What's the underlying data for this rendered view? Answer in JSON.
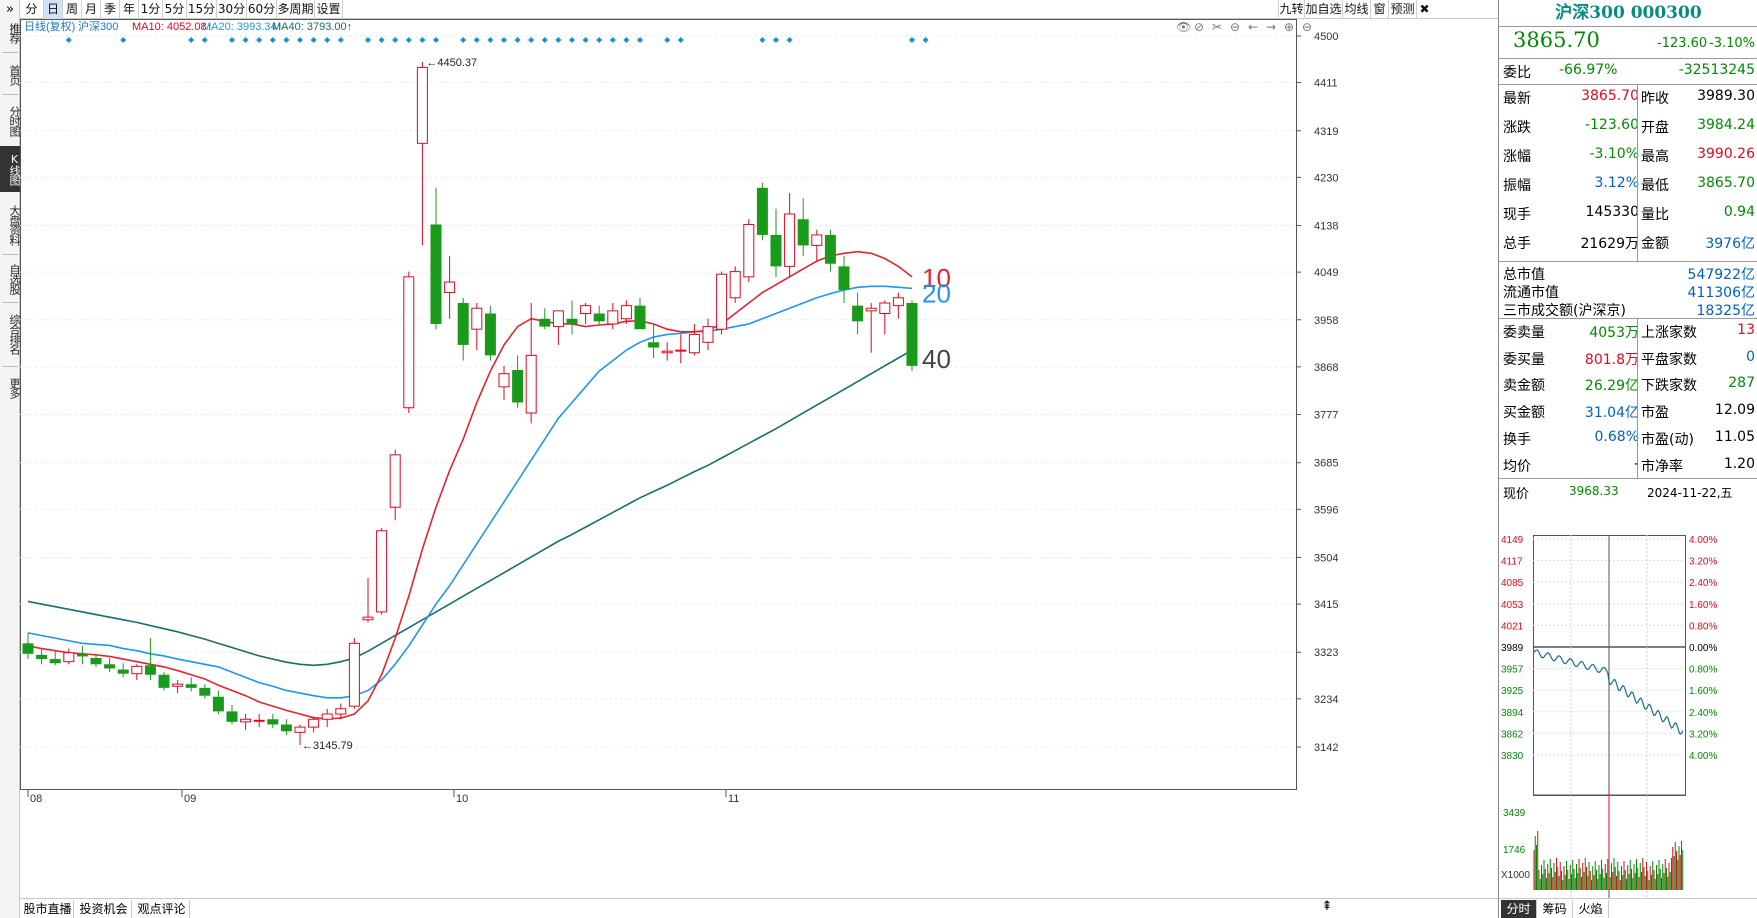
{
  "leftbar": {
    "items": [
      "推荐",
      "首页",
      "分时图",
      "K线图",
      "大盘资料",
      "自选股",
      "综合排名",
      "更多"
    ],
    "top_arrow": "»"
  },
  "toolbar": {
    "tabs": [
      "分时",
      "日",
      "周",
      "月",
      "季",
      "年",
      "1分",
      "5分",
      "15分",
      "30分",
      "60分",
      "多周期",
      "设置"
    ],
    "active": "日",
    "right_tabs": [
      "九转",
      "加自选",
      "均线",
      "窗",
      "预测"
    ],
    "close": "✖"
  },
  "ma_header": {
    "name": "日线(复权)",
    "stock": "沪深300",
    "ma10": "MA10: 4052.08↑",
    "ma20": "MA20: 3993.34↑",
    "ma40": "MA40: 3793.00↑"
  },
  "chart_icons": [
    "eye-icon",
    "eye-slash-icon",
    "scissors-icon",
    "zoom-out-icon",
    "arrow-left-icon",
    "arrow-right-icon",
    "plus-circle-icon",
    "minus-circle-icon"
  ],
  "chart_data": {
    "type": "candlestick",
    "ylim": [
      3100,
      4500
    ],
    "y_ticks": [
      "4500",
      "4411",
      "4319",
      "4230",
      "4138",
      "4049",
      "3958",
      "3868",
      "3777",
      "3685",
      "3596",
      "3504",
      "3415",
      "3323",
      "3234",
      "3142"
    ],
    "x_labels": [
      "08",
      "09",
      "10",
      "11"
    ],
    "annotations": [
      "4450.37",
      "3145.79"
    ],
    "ma_labels": [
      "10",
      "20",
      "40"
    ],
    "colors": {
      "up": "#e4081e",
      "down": "#1a9a1a",
      "ma10": "#e8222e",
      "ma20": "#2196e8",
      "ma40": "#1a6e6e",
      "diamond": "#1c90d0"
    },
    "candles": [
      [
        3340,
        3360,
        3310,
        3320
      ],
      [
        3318,
        3330,
        3300,
        3310
      ],
      [
        3310,
        3325,
        3298,
        3302
      ],
      [
        3305,
        3330,
        3300,
        3322
      ],
      [
        3320,
        3335,
        3300,
        3315
      ],
      [
        3312,
        3320,
        3295,
        3300
      ],
      [
        3300,
        3312,
        3285,
        3292
      ],
      [
        3290,
        3302,
        3275,
        3282
      ],
      [
        3282,
        3300,
        3270,
        3296
      ],
      [
        3298,
        3350,
        3270,
        3280
      ],
      [
        3280,
        3285,
        3250,
        3255
      ],
      [
        3258,
        3270,
        3245,
        3262
      ],
      [
        3262,
        3275,
        3248,
        3255
      ],
      [
        3255,
        3262,
        3235,
        3240
      ],
      [
        3238,
        3250,
        3205,
        3210
      ],
      [
        3210,
        3222,
        3185,
        3190
      ],
      [
        3190,
        3205,
        3175,
        3195
      ],
      [
        3192,
        3205,
        3180,
        3193
      ],
      [
        3195,
        3205,
        3178,
        3185
      ],
      [
        3185,
        3195,
        3165,
        3172
      ],
      [
        3170,
        3185,
        3145.79,
        3180
      ],
      [
        3180,
        3200,
        3170,
        3195
      ],
      [
        3195,
        3215,
        3180,
        3205
      ],
      [
        3205,
        3225,
        3195,
        3215
      ],
      [
        3220,
        3350,
        3215,
        3340
      ],
      [
        3385,
        3465,
        3380,
        3390
      ],
      [
        3400,
        3560,
        3395,
        3555
      ],
      [
        3600,
        3710,
        3575,
        3700
      ],
      [
        3790,
        4050,
        3780,
        4040
      ],
      [
        4295,
        4450.37,
        4100,
        4440
      ],
      [
        4140,
        4210,
        3940,
        3950
      ],
      [
        4010,
        4080,
        3960,
        4030
      ],
      [
        3990,
        4000,
        3880,
        3910
      ],
      [
        3940,
        3990,
        3900,
        3980
      ],
      [
        3970,
        3985,
        3880,
        3890
      ],
      [
        3830,
        3870,
        3805,
        3855
      ],
      [
        3862,
        3890,
        3790,
        3800
      ],
      [
        3780,
        3990,
        3760,
        3890
      ],
      [
        3960,
        3980,
        3940,
        3945
      ],
      [
        3945,
        3975,
        3910,
        3975
      ],
      [
        3960,
        3995,
        3930,
        3950
      ],
      [
        3970,
        3990,
        3950,
        3985
      ],
      [
        3970,
        3985,
        3948,
        3955
      ],
      [
        3950,
        3990,
        3940,
        3975
      ],
      [
        3960,
        3995,
        3950,
        3985
      ],
      [
        3985,
        4000,
        3940,
        3940
      ],
      [
        3915,
        3950,
        3885,
        3905
      ],
      [
        3895,
        3915,
        3880,
        3898
      ],
      [
        3900,
        3930,
        3875,
        3900
      ],
      [
        3895,
        3950,
        3890,
        3930
      ],
      [
        3915,
        3960,
        3900,
        3945
      ],
      [
        3940,
        4050,
        3930,
        4045
      ],
      [
        4000,
        4060,
        3990,
        4050
      ],
      [
        4040,
        4150,
        4030,
        4140
      ],
      [
        4210,
        4220,
        4110,
        4120
      ],
      [
        4120,
        4170,
        4040,
        4060
      ],
      [
        4060,
        4200,
        4040,
        4160
      ],
      [
        4150,
        4190,
        4080,
        4100
      ],
      [
        4100,
        4130,
        4070,
        4120
      ],
      [
        4120,
        4130,
        4050,
        4065
      ],
      [
        4060,
        4080,
        3990,
        4015
      ],
      [
        3985,
        4010,
        3930,
        3955
      ],
      [
        3975,
        3990,
        3895,
        3980
      ],
      [
        3970,
        3995,
        3930,
        3990
      ],
      [
        3985,
        4010,
        3960,
        4000
      ],
      [
        3990,
        3995,
        3860,
        3870
      ]
    ],
    "ma10": [
      3335,
      3330,
      3326,
      3322,
      3320,
      3318,
      3315,
      3310,
      3305,
      3300,
      3295,
      3288,
      3280,
      3272,
      3260,
      3250,
      3240,
      3228,
      3220,
      3212,
      3205,
      3198,
      3196,
      3197,
      3205,
      3230,
      3280,
      3350,
      3430,
      3520,
      3600,
      3670,
      3730,
      3800,
      3860,
      3910,
      3945,
      3960,
      3955,
      3950,
      3950,
      3945,
      3948,
      3950,
      3955,
      3956,
      3950,
      3940,
      3935,
      3935,
      3938,
      3950,
      3970,
      3990,
      4010,
      4025,
      4040,
      4055,
      4070,
      4080,
      4085,
      4088,
      4085,
      4075,
      4060,
      4040
    ],
    "ma20": [
      3360,
      3355,
      3350,
      3345,
      3340,
      3338,
      3336,
      3330,
      3326,
      3320,
      3316,
      3310,
      3305,
      3300,
      3295,
      3285,
      3275,
      3265,
      3258,
      3250,
      3245,
      3240,
      3236,
      3236,
      3240,
      3250,
      3270,
      3300,
      3335,
      3375,
      3415,
      3450,
      3490,
      3530,
      3570,
      3610,
      3650,
      3690,
      3730,
      3770,
      3800,
      3830,
      3860,
      3880,
      3900,
      3915,
      3925,
      3930,
      3932,
      3935,
      3936,
      3940,
      3945,
      3950,
      3960,
      3970,
      3980,
      3990,
      4000,
      4008,
      4015,
      4020,
      4022,
      4022,
      4020,
      4018
    ],
    "ma40": [
      3420,
      3415,
      3410,
      3405,
      3400,
      3395,
      3390,
      3385,
      3380,
      3374,
      3368,
      3362,
      3355,
      3348,
      3340,
      3332,
      3324,
      3316,
      3310,
      3304,
      3300,
      3298,
      3300,
      3305,
      3312,
      3325,
      3340,
      3355,
      3370,
      3385,
      3400,
      3415,
      3430,
      3445,
      3460,
      3475,
      3490,
      3505,
      3520,
      3535,
      3548,
      3562,
      3576,
      3590,
      3604,
      3618,
      3630,
      3642,
      3655,
      3668,
      3680,
      3694,
      3708,
      3722,
      3736,
      3750,
      3765,
      3780,
      3795,
      3810,
      3825,
      3840,
      3855,
      3870,
      3885,
      3900
    ],
    "signal_diamonds": [
      3,
      7,
      12,
      13,
      15,
      16,
      17,
      18,
      19,
      20,
      21,
      22,
      23,
      25,
      26,
      27,
      28,
      29,
      30,
      32,
      33,
      34,
      35,
      36,
      37,
      38,
      39,
      40,
      41,
      42,
      43,
      44,
      45,
      47,
      48,
      54,
      55,
      56,
      65,
      66
    ]
  },
  "bottom_tabs": [
    "股市直播",
    "投资机会",
    "观点评论"
  ],
  "bottom_arrow": "⇞",
  "quote": {
    "title": "沪深300 000300",
    "price": "3865.70",
    "change": "-123.60",
    "pct": "-3.10%",
    "weibi_label": "委比",
    "weibi_pct": "-66.97%",
    "weibi_val": "-32513245",
    "rows": [
      {
        "l1": "最新",
        "v1": "3865.70",
        "c1": "red",
        "l2": "昨收",
        "v2": "3989.30",
        "c2": "black"
      },
      {
        "l1": "涨跌",
        "v1": "-123.60",
        "c1": "green",
        "l2": "开盘",
        "v2": "3984.24",
        "c2": "green"
      },
      {
        "l1": "涨幅",
        "v1": "-3.10%",
        "c1": "green",
        "l2": "最高",
        "v2": "3990.26",
        "c2": "red"
      },
      {
        "l1": "振幅",
        "v1": "3.12%",
        "c1": "blue",
        "l2": "最低",
        "v2": "3865.70",
        "c2": "green"
      },
      {
        "l1": "现手",
        "v1": "145330",
        "c1": "black",
        "l2": "量比",
        "v2": "0.94",
        "c2": "green"
      },
      {
        "l1": "总手",
        "v1": "21629万",
        "c1": "black",
        "l2": "金额",
        "v2": "3976亿",
        "c2": "blue"
      }
    ],
    "mkt": [
      {
        "l": "总市值",
        "v": "547922亿"
      },
      {
        "l": "流通市值",
        "v": "411306亿"
      },
      {
        "l": "三市成交额(沪深京)",
        "v": "18325亿"
      }
    ],
    "rows2": [
      {
        "l1": "委卖量",
        "v1": "4053万",
        "c1": "green",
        "l2": "上涨家数",
        "v2": "13",
        "c2": "red"
      },
      {
        "l1": "委买量",
        "v1": "801.8万",
        "c1": "red",
        "l2": "平盘家数",
        "v2": "0",
        "c2": "blue"
      },
      {
        "l1": "卖金额",
        "v1": "26.29亿",
        "c1": "green",
        "l2": "下跌家数",
        "v2": "287",
        "c2": "green"
      },
      {
        "l1": "买金额",
        "v1": "31.04亿",
        "c1": "blue",
        "l2": "市盈",
        "v2": "12.09",
        "c2": "black"
      },
      {
        "l1": "换手",
        "v1": "0.68%",
        "c1": "blue",
        "l2": "市盈(动)",
        "v2": "11.05",
        "c2": "black"
      },
      {
        "l1": "均价",
        "v1": "-",
        "c1": "black",
        "l2": "市净率",
        "v2": "1.20",
        "c2": "black"
      }
    ]
  },
  "mini": {
    "now_label": "现价",
    "now_val": "3968.33",
    "date": "2024-11-22,五",
    "left_ticks": [
      "4149",
      "4117",
      "4085",
      "4053",
      "4021",
      "3989",
      "3957",
      "3925",
      "3894",
      "3862",
      "3830"
    ],
    "right_ticks": [
      "4.00%",
      "3.20%",
      "2.40%",
      "1.60%",
      "0.80%",
      "0.00%",
      "0.80%",
      "1.60%",
      "2.40%",
      "3.20%",
      "4.00%"
    ],
    "vol_ticks": [
      "3439",
      "1746"
    ],
    "vol_unit": "X1000",
    "tabs": [
      "分时",
      "筹码",
      "火焰"
    ]
  }
}
